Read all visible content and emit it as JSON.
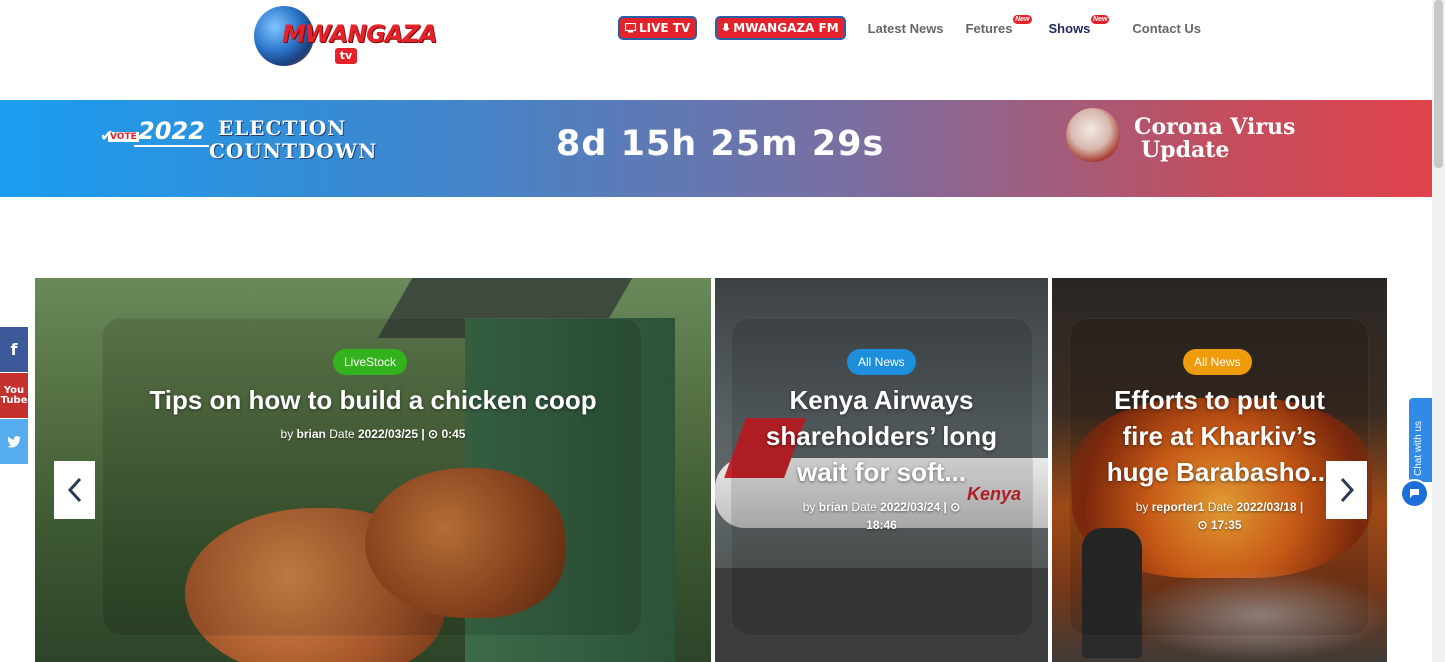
{
  "header": {
    "logo": {
      "word": "MWANGAZA",
      "tv": "tv"
    },
    "nav": {
      "live_tv": "LIVE TV",
      "fm": "MWANGAZA FM",
      "latest_news": "Latest News",
      "fetures": "Fetures",
      "shows": "Shows",
      "contact": "Contact Us",
      "new_badge": "New"
    }
  },
  "banner": {
    "vote": "VOTE",
    "year": "2022",
    "election_line1": "ELECTION",
    "election_line2": "COUNTDOWN",
    "countdown": "8d 15h 25m 29s",
    "corona_line1": "Corona Virus",
    "corona_line2": "Update"
  },
  "slides": [
    {
      "category": "LiveStock",
      "title": "Tips on how to build a chicken coop",
      "by_label": "by",
      "author": "brian",
      "date_label": "Date",
      "date": "2022/03/25 |",
      "time": "0:45"
    },
    {
      "category": "All News",
      "title_line1": "Kenya Airways",
      "title_line2": "shareholders’ long",
      "title_line3": "wait for soft...",
      "by_label": "by",
      "author": "brian",
      "date_label": "Date",
      "date": "2022/03/24 |",
      "time": "18:46",
      "plane_text": "Kenya"
    },
    {
      "category": "All News",
      "title_line1": "Efforts to put out",
      "title_line2": "fire at Kharkiv’s",
      "title_line3": "huge Barabasho...",
      "by_label": "by",
      "author": "reporter1",
      "date_label": "Date",
      "date": "2022/03/18 |",
      "time": "17:35"
    }
  ],
  "social": {
    "facebook": "f",
    "youtube": "You Tube",
    "twitter": "t"
  },
  "chat": {
    "label": "Chat with us"
  },
  "colors": {
    "accent_red": "#e3222b",
    "navy": "#1e2a5a",
    "livestock": "#32b31d",
    "allnews_blue": "#1d8fdc",
    "allnews_orange": "#f09b09"
  },
  "icons": [
    "tv-icon",
    "mic-icon",
    "clock-icon",
    "chevron-left-icon",
    "chevron-right-icon",
    "chat-icon",
    "facebook-icon",
    "youtube-icon",
    "twitter-icon"
  ]
}
